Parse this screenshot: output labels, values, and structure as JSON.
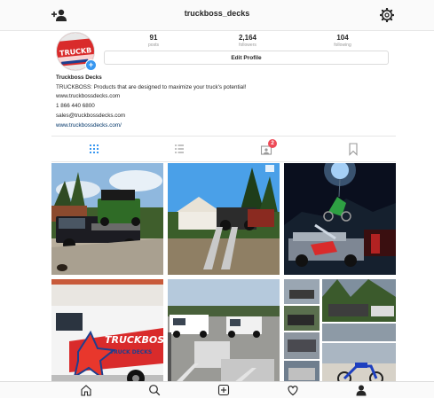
{
  "header": {
    "username": "truckboss_decks",
    "add_user_icon": "add-user-icon",
    "settings_icon": "gear-icon"
  },
  "profile": {
    "avatar_text": "TRUCKBOSS",
    "stats": [
      {
        "count": "91",
        "label": "posts"
      },
      {
        "count": "2,164",
        "label": "followers"
      },
      {
        "count": "104",
        "label": "following"
      }
    ],
    "edit_button": "Edit Profile",
    "name": "Truckboss Decks",
    "bio_lines": [
      "TRUCKBOSS: Products that are designed to maximize your truck's potential!",
      "www.truckbossdecks.com",
      "1 866 440 6800",
      "sales@truckbossdecks.com"
    ],
    "website": "www.truckbossdecks.com/"
  },
  "tabs": [
    {
      "name": "grid-view-tab",
      "icon": "grid-icon",
      "active": true
    },
    {
      "name": "list-view-tab",
      "icon": "list-icon",
      "active": false
    },
    {
      "name": "tagged-tab",
      "icon": "tagged-photo-icon",
      "badge": "2",
      "active": false
    },
    {
      "name": "saved-tab",
      "icon": "bookmark-icon",
      "active": false
    }
  ],
  "posts_visible": 6,
  "tile_overlay_text": {
    "post_4_decal": "TRUCKBOSS",
    "post_4_decal_sub": "TRUCK DECKS"
  },
  "bottom_nav": [
    "home-icon",
    "search-icon",
    "new-post-icon",
    "activity-heart-icon",
    "profile-icon"
  ],
  "colors": {
    "accent_link": "#003569",
    "badge": "#ed4956",
    "brand_red": "#d92b2b",
    "active_tab": "#3897f0"
  }
}
